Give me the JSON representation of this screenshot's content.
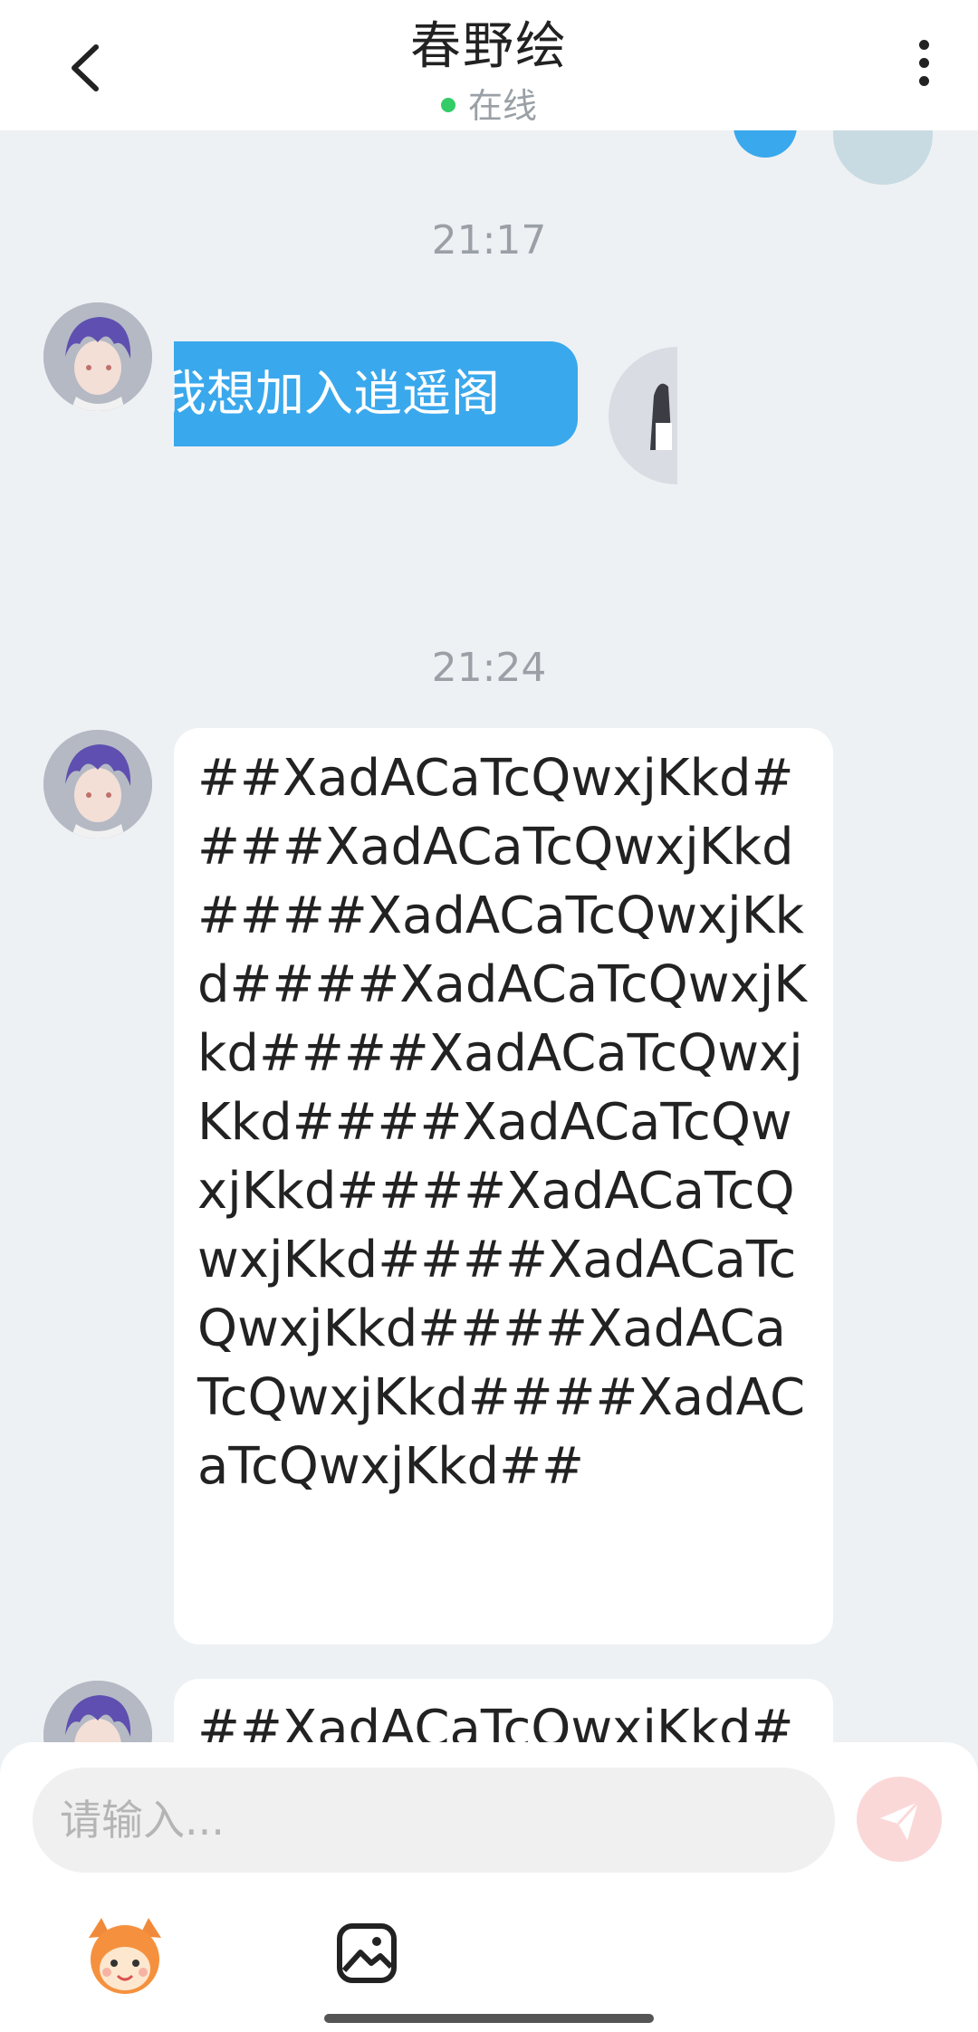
{
  "header": {
    "title": "春野绘",
    "status": "在线",
    "status_color": "#33cc66"
  },
  "messages": [
    {
      "time": "21:17",
      "card_text": "我想加入逍遥阁"
    },
    {
      "time": "21:24",
      "text": "##XadACaTcQwxjKkd####XadACaTcQwxjKkd####XadACaTcQwxjKkd####XadACaTcQwxjKkd####XadACaTcQwxjKkd####XadACaTcQwxjKkd####XadACaTcQwxjKkd####XadACaTcQwxjKkd####XadACaTcQwxjKkd####XadACaTcQwxjKkd##"
    },
    {
      "text": "##XadACaTcQwxjKkd#"
    }
  ],
  "input": {
    "placeholder": "请输入..."
  },
  "colors": {
    "accent": "#3aa8ec",
    "background": "#eef1f4",
    "send_disabled": "#fbd8d8"
  }
}
